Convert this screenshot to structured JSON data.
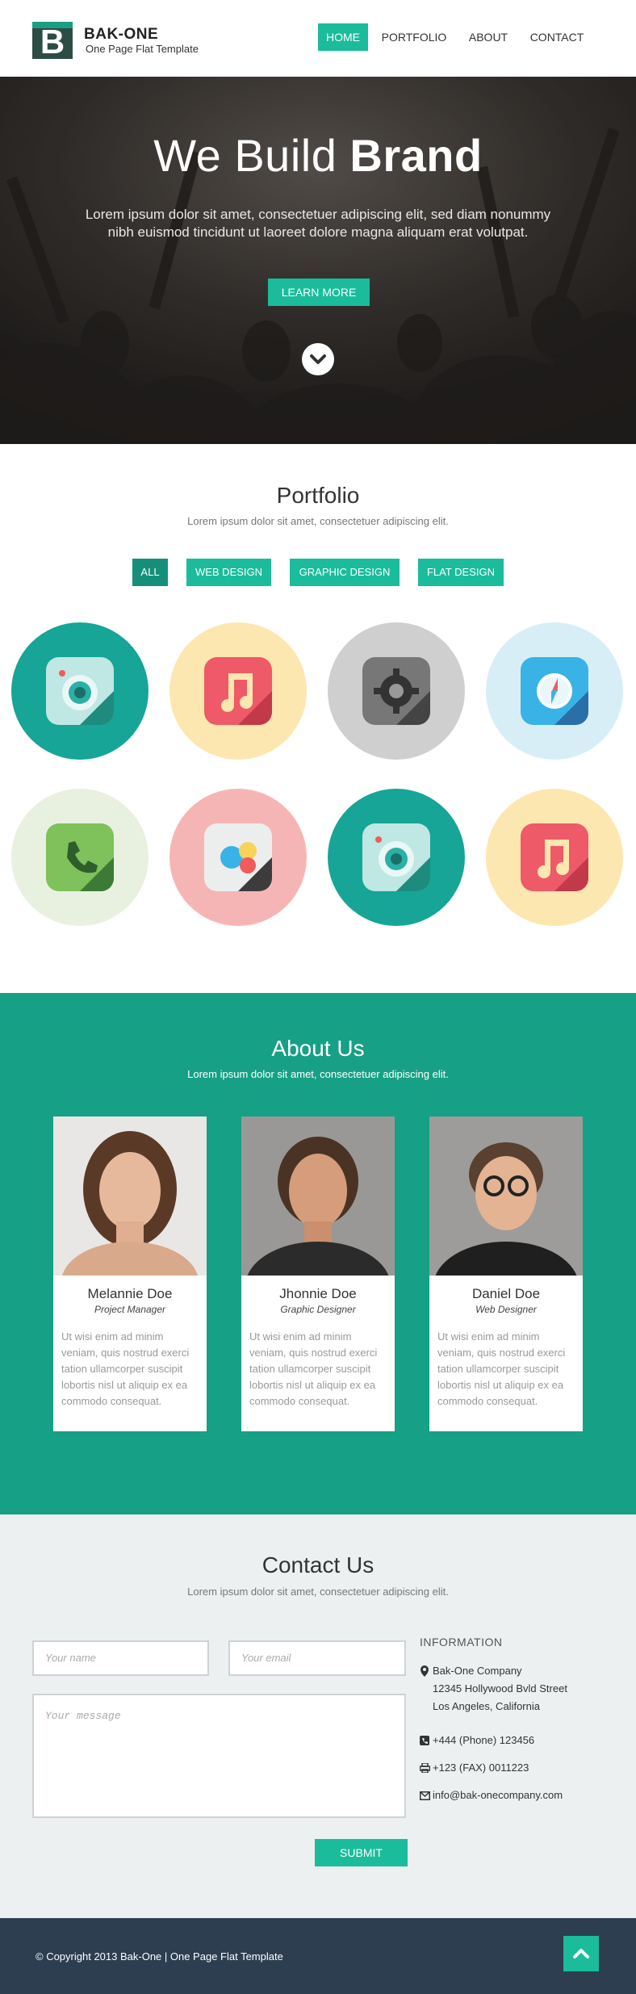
{
  "header": {
    "logo_letter": "B",
    "brand_name": "BAK-ONE",
    "tagline": "One Page Flat Template",
    "nav": [
      "HOME",
      "PORTFOLIO",
      "ABOUT",
      "CONTACT"
    ],
    "active_nav": "HOME"
  },
  "hero": {
    "title_light": "We Build ",
    "title_bold": "Brand",
    "text": "Lorem ipsum dolor sit amet, consectetuer adipiscing elit, sed diam nonummy nibh euismod tincidunt ut laoreet dolore magna aliquam erat volutpat.",
    "button": "LEARN MORE",
    "scroll_icon": "chevron-down-icon"
  },
  "portfolio": {
    "title": "Portfolio",
    "subtitle": "Lorem ipsum dolor sit amet, consectetuer adipiscing elit.",
    "filters": [
      "ALL",
      "WEB DESIGN",
      "GRAPHIC DESIGN",
      "FLAT DESIGN"
    ],
    "active_filter": "ALL",
    "items": [
      {
        "icon": "camera-icon",
        "bg": "#16a596"
      },
      {
        "icon": "music-note-icon",
        "bg": "#fde7b0"
      },
      {
        "icon": "settings-gear-icon",
        "bg": "#cfcfcf"
      },
      {
        "icon": "compass-icon",
        "bg": "#d8eef7"
      },
      {
        "icon": "phone-icon",
        "bg": "#e8f1e0"
      },
      {
        "icon": "chat-bubbles-icon",
        "bg": "#f6b5b5"
      },
      {
        "icon": "camera-icon",
        "bg": "#16a596"
      },
      {
        "icon": "music-note-icon",
        "bg": "#fde7b0"
      }
    ]
  },
  "about": {
    "title": "About Us",
    "subtitle": "Lorem ipsum dolor sit amet, consectetuer adipiscing elit.",
    "members": [
      {
        "name": "Melannie Doe",
        "role": "Project Manager",
        "bio": "Ut wisi enim ad minim veniam, quis nostrud exerci tation ullamcorper suscipit lobortis nisl ut aliquip ex ea commodo consequat."
      },
      {
        "name": "Jhonnie Doe",
        "role": "Graphic Designer",
        "bio": "Ut wisi enim ad minim veniam, quis nostrud exerci tation ullamcorper suscipit lobortis nisl ut aliquip ex ea commodo consequat."
      },
      {
        "name": "Daniel Doe",
        "role": "Web Designer",
        "bio": "Ut wisi enim ad minim veniam, quis nostrud exerci tation ullamcorper suscipit lobortis nisl ut aliquip ex ea commodo consequat."
      }
    ]
  },
  "contact": {
    "title": "Contact Us",
    "subtitle": "Lorem ipsum dolor sit amet, consectetuer adipiscing elit.",
    "name_placeholder": "Your name",
    "email_placeholder": "Your email",
    "message_placeholder": "Your message",
    "submit": "SUBMIT",
    "info_title": "INFORMATION",
    "company": "Bak-One Company",
    "address1": "12345 Hollywood Bvld Street",
    "address2": "Los Angeles, California",
    "phone": "+444 (Phone) 123456",
    "fax": "+123 (FAX) 0011223",
    "email": "info@bak-onecompany.com"
  },
  "footer": {
    "copyright": "© Copyright 2013 Bak-One | One Page Flat Template",
    "totop_icon": "chevron-up-icon"
  },
  "colors": {
    "accent": "#1abc9c",
    "about_bg": "#16a085",
    "footer_bg": "#2c3e50",
    "contact_bg": "#ecf0f1"
  }
}
